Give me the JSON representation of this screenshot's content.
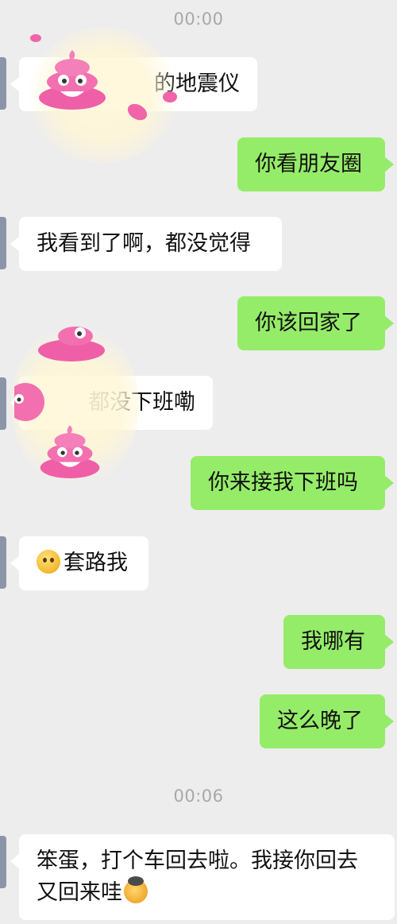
{
  "chat": {
    "timestamps": [
      "00:00",
      "00:06"
    ],
    "messages": [
      {
        "side": "received",
        "text": "的地震仪"
      },
      {
        "side": "sent",
        "text": "你看朋友圈"
      },
      {
        "side": "received",
        "text": "我看到了啊，都没觉得"
      },
      {
        "side": "sent",
        "text": "你该回家了"
      },
      {
        "side": "received",
        "text": "都没下班嘞"
      },
      {
        "side": "sent",
        "text": "你来接我下班吗"
      },
      {
        "side": "received",
        "text": "套路我",
        "emoji": "confused-face-icon"
      },
      {
        "side": "sent",
        "text": "我哪有"
      },
      {
        "side": "sent",
        "text": "这么晚了"
      },
      {
        "side": "received",
        "text": "笨蛋，打个车回去啦。我接你回去又回来哇",
        "emoji": "angry-face-icon"
      }
    ]
  },
  "overlays": {
    "effect": "poop-emoji-rain",
    "color": "#f064aa"
  },
  "colors": {
    "background": "#ededed",
    "sent_bubble": "#95ec69",
    "received_bubble": "#ffffff",
    "timestamp": "#a8a8a8"
  }
}
